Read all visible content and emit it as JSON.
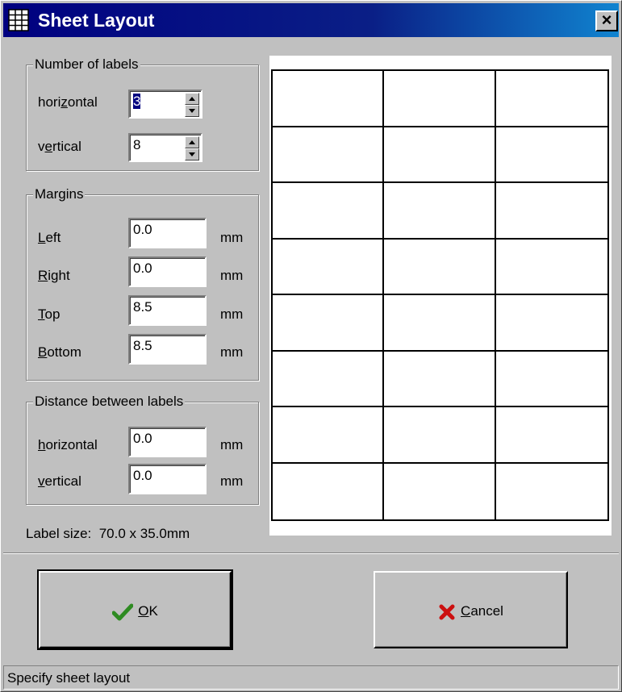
{
  "window": {
    "title": "Sheet Layout",
    "close": "×"
  },
  "number_of_labels": {
    "legend": "Number of labels",
    "horizontal": {
      "label_pre": "hori",
      "label_u": "z",
      "label_post": "ontal",
      "value": "3"
    },
    "vertical": {
      "label_pre": "v",
      "label_u": "e",
      "label_post": "rtical",
      "value": "8"
    }
  },
  "margins": {
    "legend": "Margins",
    "left": {
      "label_u": "L",
      "label_post": "eft",
      "value": "0.0",
      "unit": "mm"
    },
    "right": {
      "label_u": "R",
      "label_post": "ight",
      "value": "0.0",
      "unit": "mm"
    },
    "top": {
      "label_u": "T",
      "label_post": "op",
      "value": "8.5",
      "unit": "mm"
    },
    "bottom": {
      "label_u": "B",
      "label_post": "ottom",
      "value": "8.5",
      "unit": "mm"
    }
  },
  "distance": {
    "legend": "Distance between labels",
    "horizontal": {
      "label_u": "h",
      "label_post": "orizontal",
      "value": "0.0",
      "unit": "mm"
    },
    "vertical": {
      "label_u": "v",
      "label_post": "ertical",
      "value": "0.0",
      "unit": "mm"
    }
  },
  "label_size": "Label size:  70.0 x 35.0mm",
  "preview": {
    "columns": 3,
    "rows": 8
  },
  "buttons": {
    "ok": {
      "label_u": "O",
      "label_post": "K",
      "icon": "checkmark-icon",
      "icon_color": "#2e8b22"
    },
    "cancel": {
      "label_u": "C",
      "label_post": "ancel",
      "icon": "x-icon",
      "icon_color": "#cc1010"
    }
  },
  "status": "Specify sheet layout"
}
